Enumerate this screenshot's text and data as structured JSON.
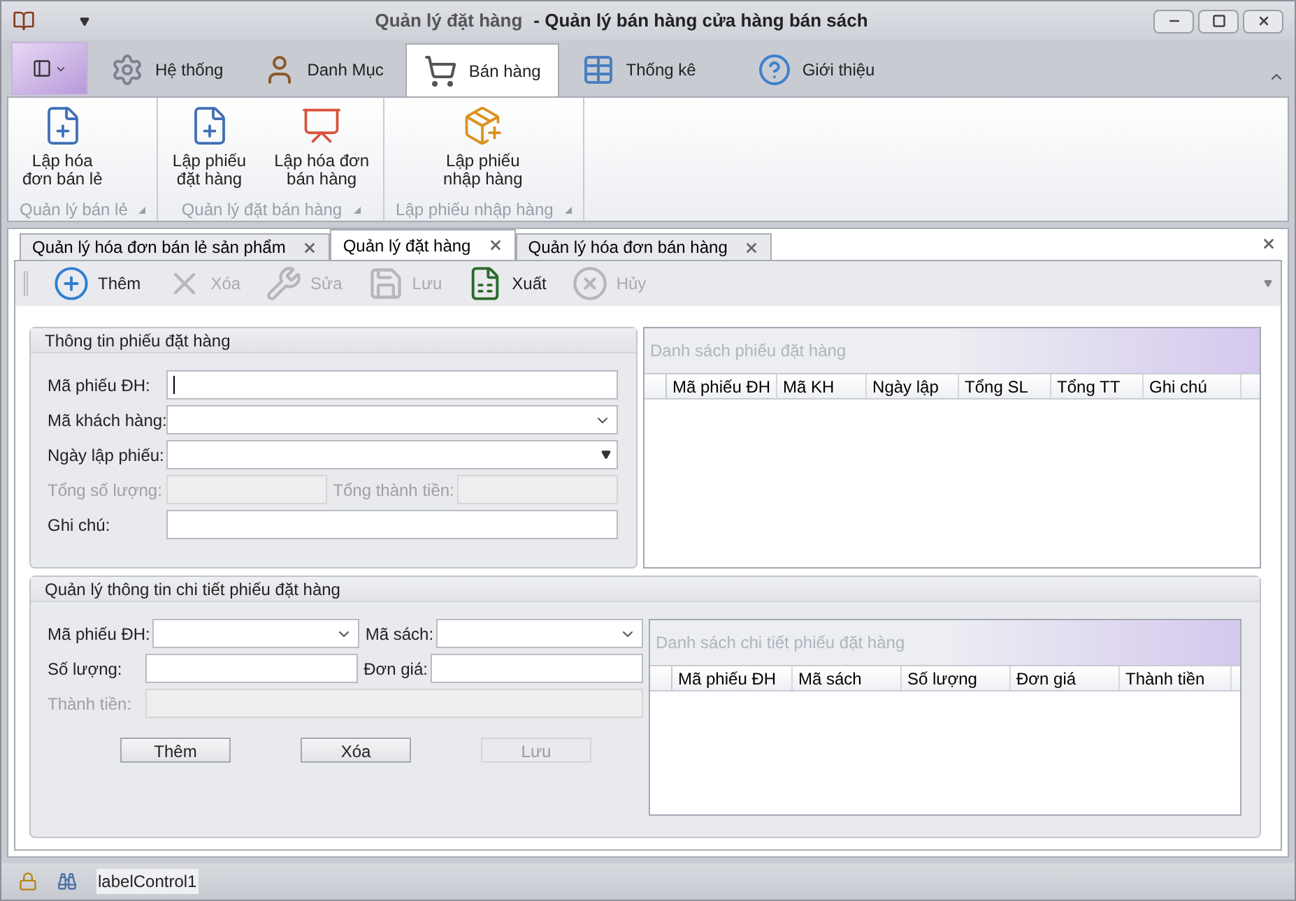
{
  "window": {
    "document_title": "Quản lý đặt hàng",
    "app_title": "- Quản lý bán hàng cửa hàng bán sách"
  },
  "ribbon": {
    "tabs": [
      {
        "label": "Hệ thống",
        "selected": false
      },
      {
        "label": "Danh Mục",
        "selected": false
      },
      {
        "label": "Bán hàng",
        "selected": true
      },
      {
        "label": "Thống kê",
        "selected": false
      },
      {
        "label": "Giới thiệu",
        "selected": false
      }
    ],
    "groups": [
      {
        "label": "Quản lý bán lẻ",
        "buttons": [
          {
            "lines": [
              "Lập hóa",
              "đơn bán lẻ"
            ]
          }
        ]
      },
      {
        "label": "Quản lý đặt bán hàng",
        "buttons": [
          {
            "lines": [
              "Lập phiếu",
              "đặt hàng"
            ]
          },
          {
            "lines": [
              "Lập hóa đơn",
              "bán hàng"
            ]
          }
        ]
      },
      {
        "label": "Lập phiếu nhập hàng",
        "buttons": [
          {
            "lines": [
              "Lập phiếu",
              "nhập hàng"
            ]
          }
        ]
      }
    ]
  },
  "document_tabs": [
    {
      "label": "Quản lý hóa đơn bán lẻ sản phẩm",
      "selected": false
    },
    {
      "label": "Quản lý đặt hàng",
      "selected": true
    },
    {
      "label": "Quản lý hóa đơn bán hàng",
      "selected": false
    }
  ],
  "toolbar": [
    {
      "label": "Thêm",
      "disabled": false
    },
    {
      "label": "Xóa",
      "disabled": true
    },
    {
      "label": "Sửa",
      "disabled": true
    },
    {
      "label": "Lưu",
      "disabled": true
    },
    {
      "label": "Xuất",
      "disabled": false
    },
    {
      "label": "Hủy",
      "disabled": true
    }
  ],
  "order_info": {
    "title": "Thông tin phiếu đặt hàng",
    "rows": [
      [
        {
          "label": "Mã phiếu ĐH:",
          "kind": "text",
          "disabled": false,
          "focused": true
        }
      ],
      [
        {
          "label": "Mã khách hàng:",
          "kind": "combo",
          "disabled": false,
          "focused": false
        }
      ],
      [
        {
          "label": "Ngày lập phiếu:",
          "kind": "date",
          "disabled": false,
          "focused": false
        }
      ],
      [
        {
          "label": "Tổng số lượng:",
          "kind": "text",
          "disabled": true,
          "focused": false
        },
        {
          "label": "Tổng thành tiền:",
          "kind": "text",
          "disabled": true,
          "focused": false
        }
      ],
      [
        {
          "label": "Ghi chú:",
          "kind": "text",
          "disabled": false,
          "focused": false
        }
      ]
    ]
  },
  "order_list": {
    "title": "Danh sách phiếu đặt hàng",
    "columns": [
      "Mã phiếu ĐH",
      "Mã KH",
      "Ngày lập",
      "Tổng SL",
      "Tổng TT",
      "Ghi chú"
    ]
  },
  "detail": {
    "title": "Quản lý thông tin chi tiết phiếu đặt hàng",
    "rows": [
      [
        {
          "label": "Mã phiếu ĐH:",
          "kind": "combo",
          "disabled": false,
          "focused": false
        },
        {
          "label": "Mã sách:",
          "kind": "combo",
          "disabled": false,
          "focused": false
        }
      ],
      [
        {
          "label": "Số lượng:",
          "kind": "text",
          "disabled": false,
          "focused": false
        },
        {
          "label": "Đơn giá:",
          "kind": "text",
          "disabled": false,
          "focused": false
        }
      ],
      [
        {
          "label": "Thành tiền:",
          "kind": "text",
          "disabled": true,
          "focused": false
        }
      ]
    ],
    "buttons": [
      {
        "label": "Thêm",
        "disabled": false
      },
      {
        "label": "Xóa",
        "disabled": false
      },
      {
        "label": "Lưu",
        "disabled": true
      }
    ],
    "list": {
      "title": "Danh sách chi tiết phiếu đặt hàng",
      "columns": [
        "Mã phiếu ĐH",
        "Mã sách",
        "Số lượng",
        "Đơn giá",
        "Thành tiền"
      ]
    }
  },
  "status_bar": {
    "label": "labelControl1"
  }
}
